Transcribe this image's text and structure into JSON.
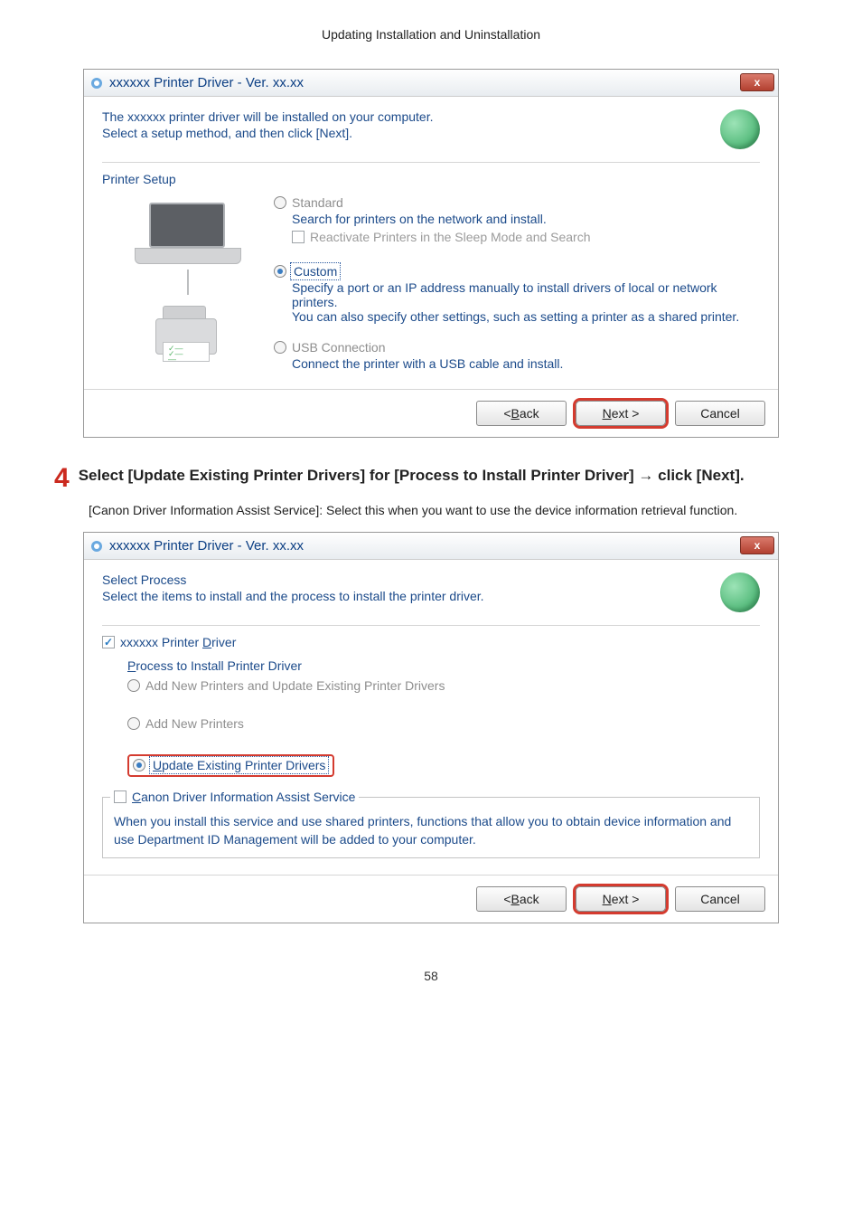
{
  "page": {
    "breadcrumb": "Updating Installation and Uninstallation",
    "number": "58"
  },
  "dialog1": {
    "title": "xxxxxx Printer Driver - Ver. xx.xx",
    "close": "x",
    "heading_line1": "The xxxxxx printer driver will be installed on your computer.",
    "heading_line2": "Select a setup method, and then click [Next].",
    "section_title": "Printer Setup",
    "opt_standard": "Standard",
    "desc_standard": "Search for printers on the network and install.",
    "chk_reactivate": "Reactivate Printers in the Sleep Mode and Search",
    "opt_custom": "Custom",
    "desc_custom": "Specify a port or an IP address manually to install drivers of local or network printers.\nYou can also specify other settings, such as setting a printer as a shared printer.",
    "opt_usb": "USB Connection",
    "desc_usb": "Connect the printer with a USB cable and install.",
    "btn_back": "< Back",
    "btn_next": "Next >",
    "btn_cancel": "Cancel"
  },
  "step4": {
    "num": "4",
    "text": "Select [Update Existing Printer Drivers] for [Process to Install Printer Driver] → click [Next].",
    "note": "[Canon Driver Information Assist Service]: Select this when you want to use the device information retrieval function."
  },
  "dialog2": {
    "title": "xxxxxx Printer Driver - Ver. xx.xx",
    "close": "x",
    "heading_line1": "Select Process",
    "heading_line2": "Select the items to install and the process to install the printer driver.",
    "chk_driver": "xxxxxx Printer Driver",
    "process_label": "Process to Install Printer Driver",
    "opt_addupdate": "Add New Printers and Update Existing Printer Drivers",
    "opt_addnew": "Add New Printers",
    "opt_update": "Update Existing Printer Drivers",
    "svc_label": "Canon Driver Information Assist Service",
    "svc_desc": "When you install this service and use shared printers, functions that allow you to obtain device information and use Department ID Management will be added to your computer.",
    "btn_back": "< Back",
    "btn_next": "Next >",
    "btn_cancel": "Cancel"
  }
}
